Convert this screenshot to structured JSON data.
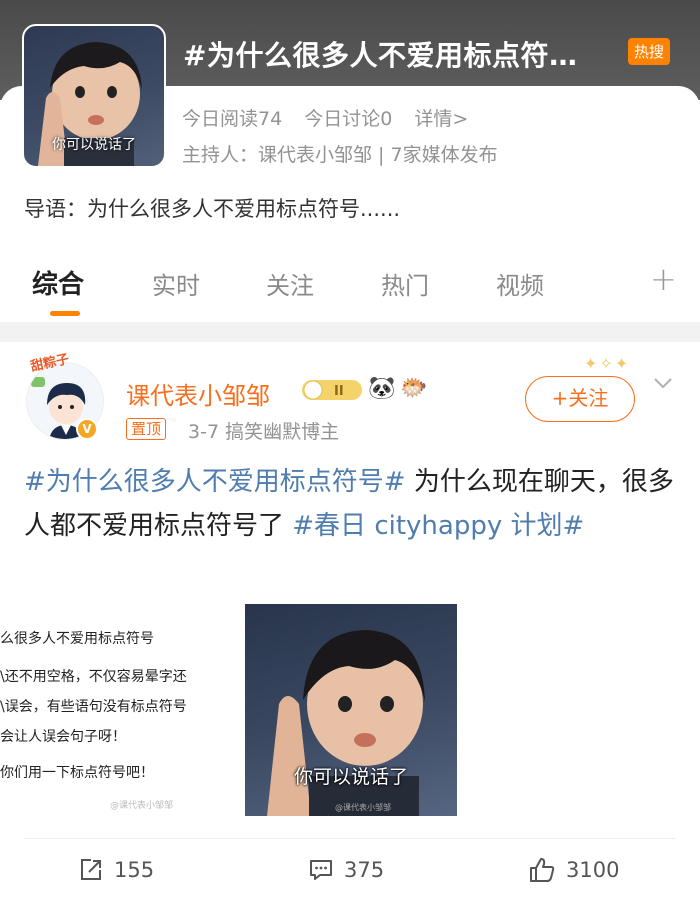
{
  "topic": {
    "title": "#为什么很多人不爱用标点符…",
    "hot_badge": "热搜",
    "thumb_caption": "你可以说话了",
    "stats": {
      "reads": "今日阅读74",
      "discussions": "今日讨论0",
      "details": "详情>"
    },
    "host": "主持人：课代表小邹邹 | 7家媒体发布",
    "intro": "导语：为什么很多人不爱用标点符号......"
  },
  "tabs": [
    {
      "label": "综合"
    },
    {
      "label": "实时"
    },
    {
      "label": "关注"
    },
    {
      "label": "热门"
    },
    {
      "label": "视频"
    }
  ],
  "tab_plus": "+",
  "post": {
    "avatar_sticker": "甜粽子",
    "author": "课代表小邹邹",
    "level": "II",
    "pinned": "置顶",
    "meta": "3-7  搞笑幽默博主",
    "follow": "+关注",
    "text": {
      "tag1": "#为什么很多人不爱用标点符号#",
      "body": " 为什么现在聊天，很多人都不爱用标点符号了 ",
      "tag2": "#春日 cityhappy 计划#"
    },
    "image_left": {
      "lines": [
        "么很多人不爱用标点符号",
        "\\还不用空格，不仅容易晕字还",
        "\\误会，有些语句没有标点符号",
        "会让人误会句子呀！",
        "你们用一下标点符号吧！"
      ],
      "watermark": "@课代表小邹邹"
    },
    "image_right": {
      "caption": "你可以说话了",
      "watermark": "@课代表小邹邹"
    },
    "actions": {
      "reposts": "155",
      "comments": "375",
      "likes": "3100"
    }
  },
  "colors": {
    "accent": "#ff8200",
    "author": "#f86f1e",
    "hashtag": "#507daf"
  }
}
